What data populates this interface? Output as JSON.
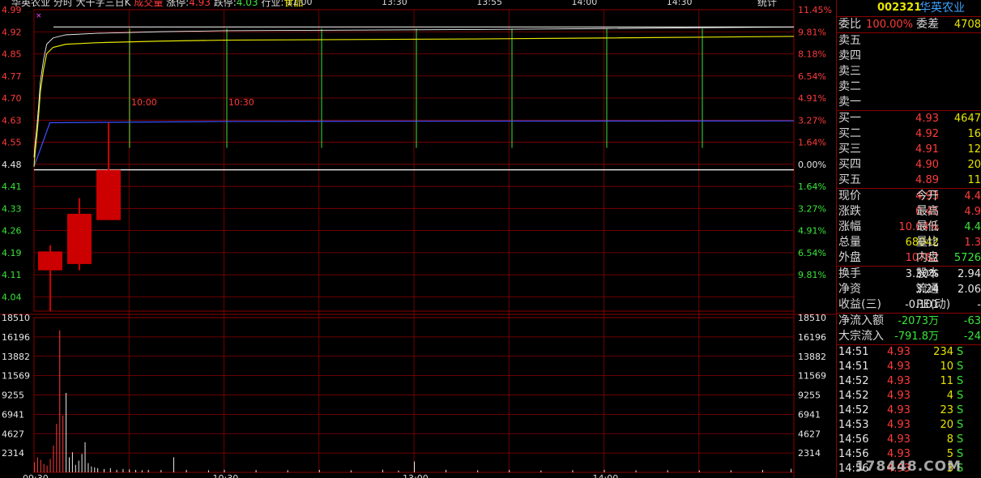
{
  "header": {
    "stock_name": "华英农业",
    "period": "分时",
    "note": "大干字三日K",
    "vol_label": "成交量",
    "limit_up_label": "涨停:",
    "limit_up": "4.93",
    "limit_down_label": "跌停:",
    "limit_down": "4.03",
    "industry_label": "行业:",
    "industry": "食品",
    "stats_button": "统计"
  },
  "panel": {
    "code": "002321",
    "name": "华英农业",
    "weibi_label": "委比",
    "weibi": "100.00%",
    "weicha_label": "委差",
    "weicha": "4708",
    "sell": [
      {
        "label": "卖五",
        "price": "",
        "vol": ""
      },
      {
        "label": "卖四",
        "price": "",
        "vol": ""
      },
      {
        "label": "卖三",
        "price": "",
        "vol": ""
      },
      {
        "label": "卖二",
        "price": "",
        "vol": ""
      },
      {
        "label": "卖一",
        "price": "",
        "vol": ""
      }
    ],
    "buy": [
      {
        "label": "买一",
        "price": "4.93",
        "vol": "4647"
      },
      {
        "label": "买二",
        "price": "4.92",
        "vol": "16"
      },
      {
        "label": "买三",
        "price": "4.91",
        "vol": "12"
      },
      {
        "label": "买四",
        "price": "4.90",
        "vol": "20"
      },
      {
        "label": "买五",
        "price": "4.89",
        "vol": "11"
      }
    ],
    "quote": [
      {
        "l1": "现价",
        "v1": "4.93",
        "c1": "red",
        "l2": "今开",
        "v2": "4.4",
        "c2": "red"
      },
      {
        "l1": "涨跌",
        "v1": "0.45",
        "c1": "red",
        "l2": "最高",
        "v2": "4.9",
        "c2": "red"
      },
      {
        "l1": "涨幅",
        "v1": "10.04%",
        "c1": "red",
        "l2": "最低",
        "v2": "4.4",
        "c2": "grn"
      },
      {
        "l1": "总量",
        "v1": "68042",
        "c1": "yel",
        "l2": "量比",
        "v2": "1.3",
        "c2": "red"
      },
      {
        "l1": "外盘",
        "v1": "10782",
        "c1": "red",
        "l2": "内盘",
        "v2": "5726",
        "c2": "grn"
      }
    ],
    "fund": [
      {
        "l1": "换手",
        "v1": "3.30%",
        "c1": "wht",
        "l2": "股本",
        "v2": "2.94",
        "c2": "wht"
      },
      {
        "l1": "净资",
        "v1": "3.24",
        "c1": "wht",
        "l2": "流通",
        "v2": "2.06",
        "c2": "wht"
      },
      {
        "l1": "收益(三)",
        "v1": "-0.101",
        "c1": "wht",
        "l2": "PE(动)",
        "v2": "-",
        "c2": "wht"
      }
    ],
    "flow": [
      {
        "label": "净流入额",
        "v1": "-2073万",
        "v2": "-63"
      },
      {
        "label": "大宗流入",
        "v1": "-791.8万",
        "v2": "-24"
      }
    ],
    "ticks": [
      {
        "time": "14:51",
        "price": "4.93",
        "vol": "234",
        "side": "S"
      },
      {
        "time": "14:51",
        "price": "4.93",
        "vol": "10",
        "side": "S"
      },
      {
        "time": "14:52",
        "price": "4.93",
        "vol": "11",
        "side": "S"
      },
      {
        "time": "14:52",
        "price": "4.93",
        "vol": "4",
        "side": "S"
      },
      {
        "time": "14:52",
        "price": "4.93",
        "vol": "23",
        "side": "S"
      },
      {
        "time": "14:53",
        "price": "4.93",
        "vol": "20",
        "side": "S"
      },
      {
        "time": "14:56",
        "price": "4.93",
        "vol": "8",
        "side": "S"
      },
      {
        "time": "14:56",
        "price": "4.93",
        "vol": "5",
        "side": "S"
      },
      {
        "time": "14:56",
        "price": "4.93",
        "vol": "3",
        "side": "S"
      }
    ]
  },
  "watermark": "178448.COM",
  "chart_data": {
    "type": "line",
    "price_axis": [
      "4.99",
      "4.92",
      "4.85",
      "4.77",
      "4.70",
      "4.63",
      "4.55",
      "4.48",
      "4.41",
      "4.33",
      "4.26",
      "4.19",
      "4.11",
      "4.04"
    ],
    "pct_axis": [
      "11.45%",
      "9.81%",
      "8.18%",
      "6.54%",
      "4.91%",
      "3.27%",
      "1.64%",
      "0.00%",
      "1.64%",
      "3.27%",
      "4.91%",
      "6.54%",
      "9.81%"
    ],
    "prev_close": 4.48,
    "price_range": [
      4.03,
      4.99
    ],
    "vol_axis": [
      "18510",
      "16196",
      "13882",
      "11569",
      "9255",
      "6941",
      "4627",
      "2314"
    ],
    "vol_max": 18510,
    "time_axis": [
      "09:30",
      "10:30",
      "13:00",
      "14:00"
    ],
    "top_time_labels": [
      "11:00",
      "13:30",
      "13:55",
      "14:00",
      "14:30"
    ],
    "marker_labels": [
      "10:00",
      "10:30"
    ],
    "price_series": [
      [
        0,
        4.49
      ],
      [
        0.3,
        4.53
      ],
      [
        0.6,
        4.56
      ],
      [
        1,
        4.6
      ],
      [
        1.5,
        4.66
      ],
      [
        2,
        4.73
      ],
      [
        3,
        4.8
      ],
      [
        4,
        4.85
      ],
      [
        6,
        4.87
      ],
      [
        10,
        4.88
      ],
      [
        20,
        4.885
      ],
      [
        40,
        4.89
      ],
      [
        60,
        4.893
      ],
      [
        100,
        4.895
      ],
      [
        140,
        4.897
      ],
      [
        180,
        4.9
      ],
      [
        240,
        4.905
      ]
    ],
    "avg_series": [
      [
        0,
        4.49
      ],
      [
        5,
        4.63
      ],
      [
        60,
        4.634
      ],
      [
        120,
        4.635
      ],
      [
        240,
        4.636
      ]
    ],
    "candles": [
      {
        "open": 4.22,
        "close": 4.16,
        "high": 4.24,
        "low": 4.03
      },
      {
        "open": 4.18,
        "close": 4.34,
        "high": 4.39,
        "low": 4.16
      },
      {
        "open": 4.32,
        "close": 4.48,
        "high": 4.63,
        "low": 4.32
      }
    ],
    "volumes": [
      [
        0,
        1200
      ],
      [
        1,
        1800
      ],
      [
        2,
        1500
      ],
      [
        3,
        1000
      ],
      [
        4,
        800
      ],
      [
        5,
        1600
      ],
      [
        6,
        3200
      ],
      [
        7,
        5800
      ],
      [
        8,
        17000
      ],
      [
        9,
        6800
      ],
      [
        10,
        9500
      ],
      [
        11,
        1800
      ],
      [
        12,
        2400
      ],
      [
        13,
        900
      ],
      [
        14,
        1400
      ],
      [
        15,
        2200
      ],
      [
        16,
        3600
      ],
      [
        17,
        1100
      ],
      [
        18,
        700
      ],
      [
        19,
        600
      ],
      [
        20,
        500
      ],
      [
        22,
        400
      ],
      [
        24,
        500
      ],
      [
        26,
        300
      ],
      [
        28,
        400
      ],
      [
        30,
        350
      ],
      [
        32,
        300
      ],
      [
        34,
        250
      ],
      [
        36,
        300
      ],
      [
        40,
        280
      ],
      [
        44,
        1800
      ],
      [
        48,
        300
      ],
      [
        55,
        250
      ],
      [
        60,
        300
      ],
      [
        70,
        280
      ],
      [
        80,
        260
      ],
      [
        90,
        300
      ],
      [
        100,
        250
      ],
      [
        110,
        320
      ],
      [
        115,
        220
      ],
      [
        120,
        1300
      ],
      [
        130,
        300
      ],
      [
        140,
        250
      ],
      [
        150,
        280
      ],
      [
        160,
        230
      ],
      [
        170,
        260
      ],
      [
        180,
        300
      ],
      [
        190,
        240
      ],
      [
        200,
        260
      ],
      [
        210,
        230
      ],
      [
        220,
        250
      ],
      [
        230,
        300
      ],
      [
        239,
        420
      ]
    ]
  }
}
